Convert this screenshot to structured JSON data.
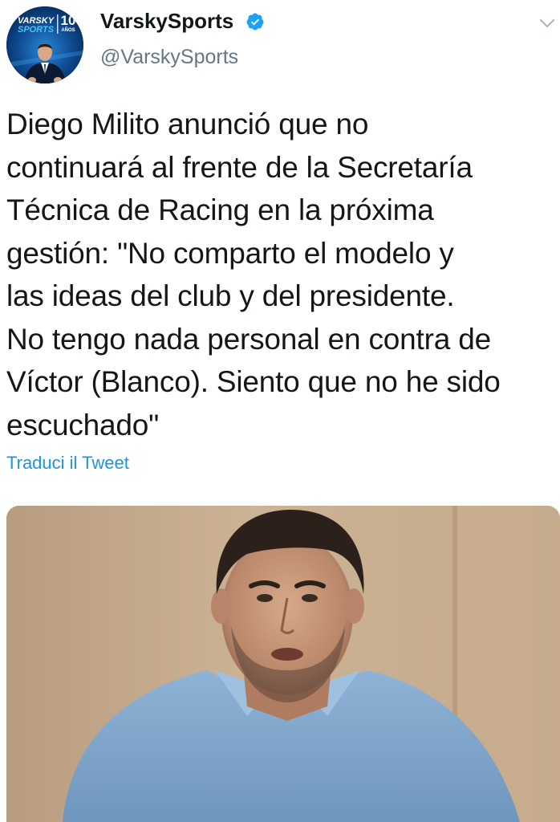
{
  "account": {
    "display_name": "VarskySports",
    "handle": "@VarskySports",
    "verified": true,
    "avatar_logo": {
      "line1": "VARSKY",
      "line2": "SPORTS",
      "number": "10",
      "sub": "AÑOS"
    }
  },
  "tweet": {
    "text": "Diego Milito anunció que no\ncontinuará al frente de la Secretaría\nTécnica de Racing en la próxima\ngestión: \"No comparto el modelo y\nlas ideas del club y del presidente.\nNo tengo nada personal en contra de\nVíctor (Blanco). Siento que no he sido\nescuchado\"",
    "translate_label": "Traduci il Tweet"
  },
  "icons": {
    "verified": "verified-badge-icon",
    "more": "chevron-down-icon"
  },
  "colors": {
    "text": "#14171a",
    "secondary": "#657786",
    "link": "#1b95e0",
    "verified": "#1da1f2"
  }
}
